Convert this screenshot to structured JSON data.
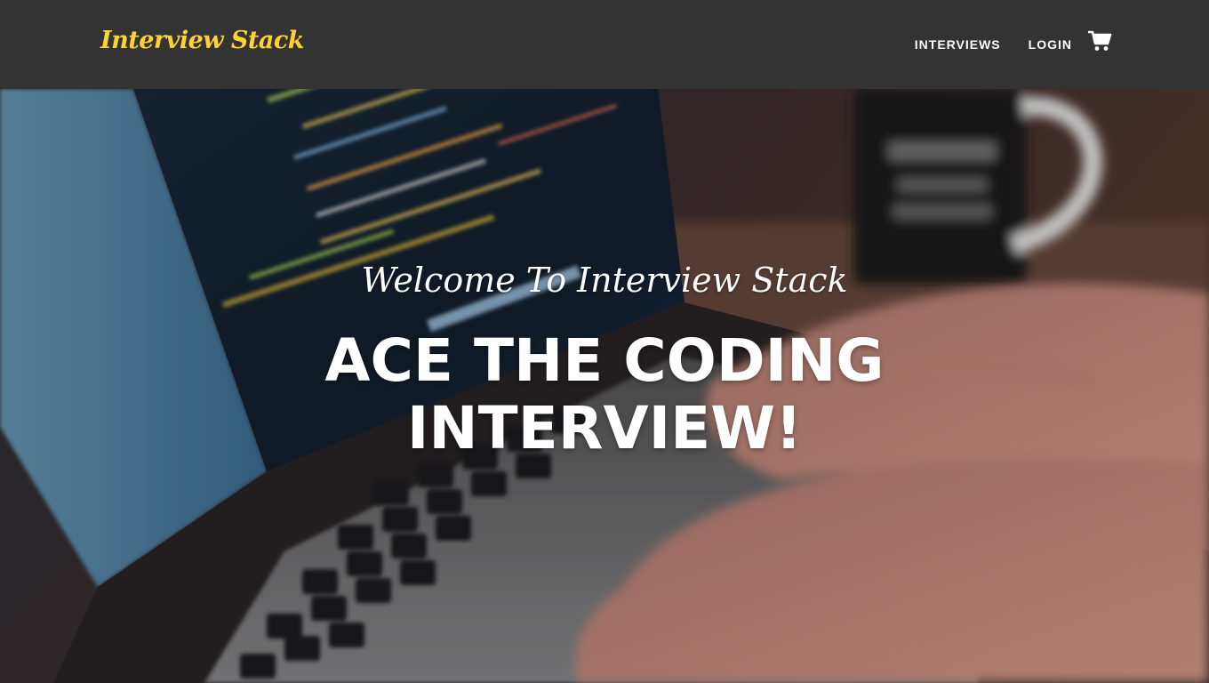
{
  "navbar": {
    "brand": "Interview Stack",
    "links": [
      {
        "label": "INTERVIEWS"
      },
      {
        "label": "LOGIN"
      }
    ],
    "cart_icon": "shopping-cart-icon"
  },
  "hero": {
    "subheading": "Welcome To Interview Stack",
    "heading": "ACE THE CODING INTERVIEW!",
    "background_image": "laptop-code-typing-photo"
  },
  "colors": {
    "navbar_bg": "#333333",
    "brand": "#fed136",
    "nav_text": "#ffffff",
    "hero_text": "#ffffff"
  }
}
